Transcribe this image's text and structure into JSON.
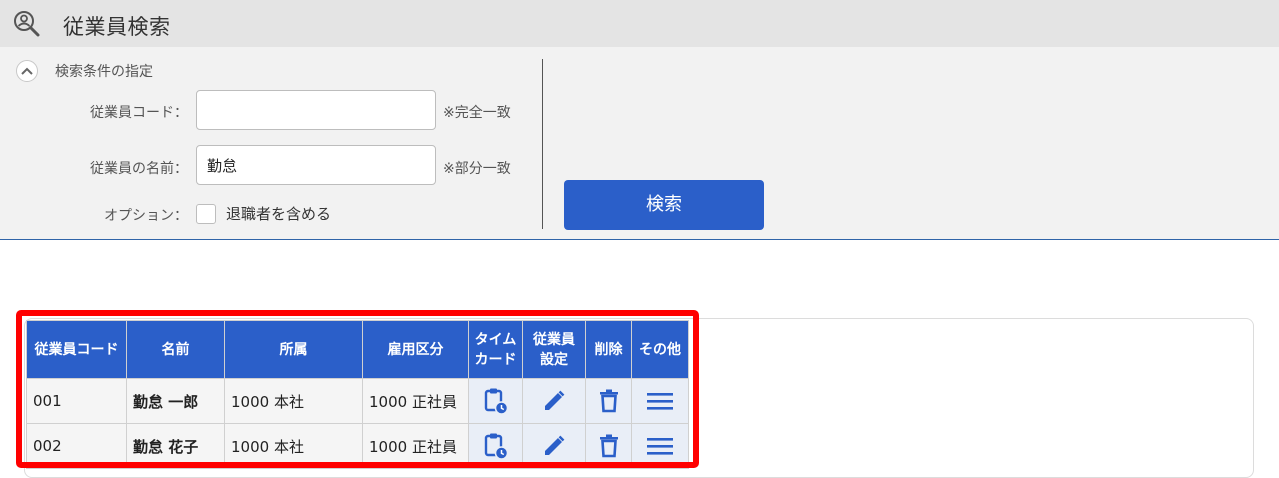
{
  "header": {
    "title": "従業員検索",
    "icon": "person-search-icon"
  },
  "search": {
    "section_title": "検索条件の指定",
    "collapse_icon": "chevron-up-icon",
    "code_label": "従業員コード：",
    "code_value": "",
    "code_hint": "※完全一致",
    "name_label": "従業員の名前：",
    "name_value": "勤怠",
    "name_hint": "※部分一致",
    "option_label": "オプション：",
    "option_checkbox_label": "退職者を含める",
    "option_checked": false,
    "button_label": "検索"
  },
  "table": {
    "headers": {
      "code": "従業員コード",
      "name": "名前",
      "dept": "所属",
      "type": "雇用区分",
      "timecard_1": "タイム",
      "timecard_2": "カード",
      "settings_1": "従業員",
      "settings_2": "設定",
      "delete": "削除",
      "other": "その他"
    },
    "rows": [
      {
        "code": "001",
        "name": "勤怠 一郎",
        "dept": "1000 本社",
        "type": "1000 正社員"
      },
      {
        "code": "002",
        "name": "勤怠 花子",
        "dept": "1000 本社",
        "type": "1000 正社員"
      }
    ]
  },
  "colors": {
    "accent": "#2b5fc9",
    "highlight": "#ff0000",
    "header_bg": "#e4e4e4",
    "panel_bg": "#f2f2f2"
  }
}
